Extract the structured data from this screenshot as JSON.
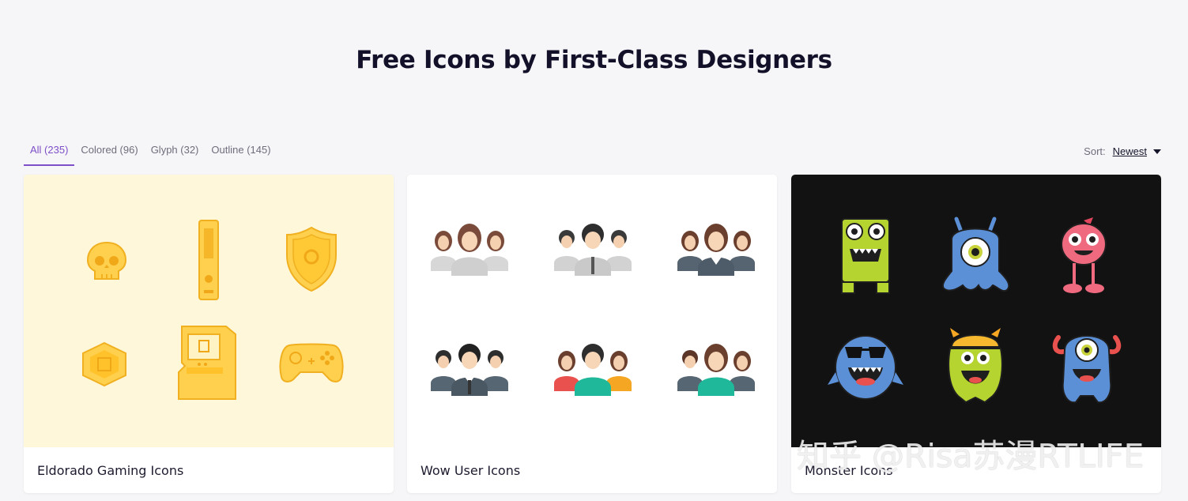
{
  "page": {
    "title": "Free Icons by First-Class Designers"
  },
  "filters": {
    "tabs": [
      {
        "label": "All (235)"
      },
      {
        "label": "Colored (96)"
      },
      {
        "label": "Glyph (32)"
      },
      {
        "label": "Outline (145)"
      }
    ],
    "sort_label": "Sort:",
    "sort_value": "Newest"
  },
  "packs": [
    {
      "name": "Eldorado Gaming Icons",
      "icons": [
        "skull-icon",
        "console-icon",
        "shield-icon",
        "coin-icon",
        "arcade-machine-icon",
        "gamepad-icon"
      ]
    },
    {
      "name": "Wow User Icons",
      "icons": [
        "women-group-icon",
        "businessmen-group-icon",
        "business-team-icon",
        "suits-group-icon",
        "colorful-team-icon",
        "mixed-team-icon"
      ]
    },
    {
      "name": "Monster Icons",
      "icons": [
        "square-monster-icon",
        "cyclops-blob-monster-icon",
        "pink-monster-icon",
        "sunglasses-monster-icon",
        "helmet-monster-icon",
        "horned-cyclops-monster-icon"
      ]
    }
  ],
  "watermark": "知乎 @Risa苏漫RTLIFE",
  "colors": {
    "accent": "#7d4fc8",
    "gold": "#ffc935",
    "dark_bg": "#121212",
    "cream_bg": "#fff7da"
  }
}
